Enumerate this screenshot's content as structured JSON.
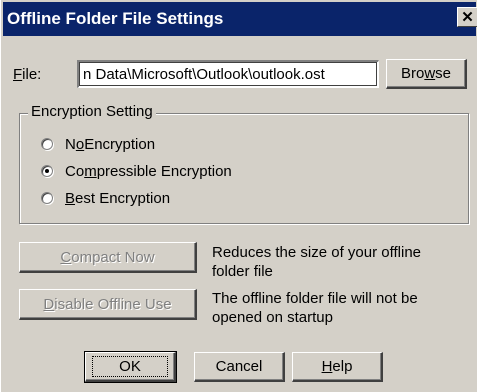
{
  "window": {
    "title": "Offline Folder File Settings",
    "close_glyph": "✕"
  },
  "file": {
    "label_prefix": "",
    "label_mnemonic": "F",
    "label_suffix": "ile:",
    "value": "n Data\\Microsoft\\Outlook\\outlook.ost",
    "browse_prefix": "Bro",
    "browse_mnemonic": "w",
    "browse_suffix": "se"
  },
  "encryption": {
    "group_title": "Encryption Setting",
    "options": [
      {
        "prefix": "N",
        "mnemonic": "o",
        "suffix": " Encryption",
        "checked": false
      },
      {
        "prefix": "Co",
        "mnemonic": "m",
        "suffix": "pressible Encryption",
        "checked": true
      },
      {
        "prefix": "",
        "mnemonic": "B",
        "suffix": "est Encryption",
        "checked": false
      }
    ]
  },
  "actions": {
    "compact": {
      "prefix": "",
      "mnemonic": "C",
      "suffix": "ompact Now",
      "disabled": true,
      "description_line1": "Reduces the size of your offline",
      "description_line2": "folder file"
    },
    "disable": {
      "prefix": "",
      "mnemonic": "D",
      "suffix": "isable Offline Use",
      "disabled": true,
      "description_line1": "The offline folder file will not be",
      "description_line2": "opened on startup"
    }
  },
  "footer": {
    "ok_label": "OK",
    "cancel_label": "Cancel",
    "help_prefix": "",
    "help_mnemonic": "H",
    "help_suffix": "elp"
  },
  "colors": {
    "title_bar": "#0a246a",
    "dialog_face": "#d4d0c8",
    "disabled_text": "#808080"
  }
}
